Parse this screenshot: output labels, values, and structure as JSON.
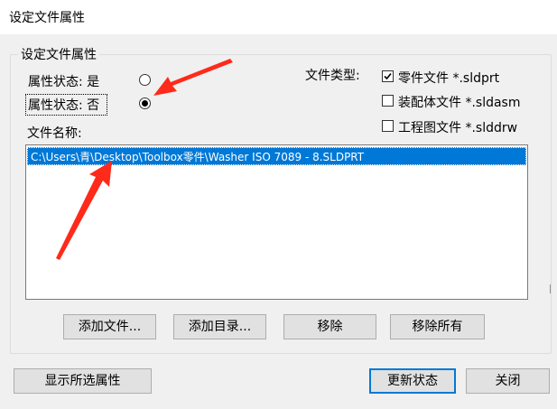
{
  "window": {
    "title": "设定文件属性"
  },
  "group": {
    "legend": "设定文件属性",
    "property_yes_label": "属性状态: 是",
    "property_no_label": "属性状态: 否",
    "selected_radio": "no",
    "file_type_label": "文件类型:",
    "file_types": [
      {
        "label": "零件文件 *.sldprt",
        "checked": true
      },
      {
        "label": "装配体文件 *.sldasm",
        "checked": false
      },
      {
        "label": "工程图文件 *.slddrw",
        "checked": false
      }
    ],
    "file_name_label": "文件名称:",
    "files": [
      "C:\\Users\\青\\Desktop\\Toolbox零件\\Washer ISO 7089 - 8.SLDPRT"
    ],
    "buttons": {
      "add_file": "添加文件...",
      "add_dir": "添加目录...",
      "remove": "移除",
      "remove_all": "移除所有"
    }
  },
  "footer": {
    "show_selected": "显示所选属性",
    "update_status": "更新状态",
    "close": "关闭"
  },
  "annotation_color": "#ff2a1a",
  "selection_color": "#0078d7"
}
